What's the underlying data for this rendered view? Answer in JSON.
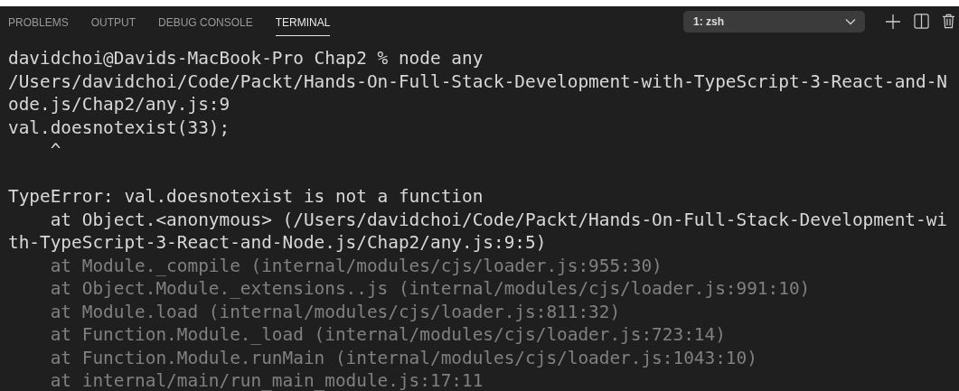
{
  "tabs": [
    {
      "label": "PROBLEMS",
      "selected": false
    },
    {
      "label": "OUTPUT",
      "selected": false
    },
    {
      "label": "DEBUG CONSOLE",
      "selected": false
    },
    {
      "label": "TERMINAL",
      "selected": true
    }
  ],
  "terminal_select": {
    "value": "1: zsh"
  },
  "terminal": {
    "blocks": [
      [
        {
          "kind": "normal",
          "text": "davidchoi@Davids-MacBook-Pro Chap2 % node any"
        },
        {
          "kind": "normal",
          "text": "/Users/davidchoi/Code/Packt/Hands-On-Full-Stack-Development-with-TypeScript-3-React-and-N"
        },
        {
          "kind": "normal",
          "text": "ode.js/Chap2/any.js:9"
        },
        {
          "kind": "normal",
          "text": "val.doesnotexist(33);"
        },
        {
          "kind": "normal",
          "text": "    ^"
        }
      ],
      [
        {
          "kind": "normal",
          "text": "TypeError: val.doesnotexist is not a function"
        },
        {
          "kind": "normal",
          "text": "    at Object.<anonymous> (/Users/davidchoi/Code/Packt/Hands-On-Full-Stack-Development-wi"
        },
        {
          "kind": "normal",
          "text": "th-TypeScript-3-React-and-Node.js/Chap2/any.js:9:5)"
        },
        {
          "kind": "dim",
          "text": "    at Module._compile (internal/modules/cjs/loader.js:955:30)"
        },
        {
          "kind": "dim",
          "text": "    at Object.Module._extensions..js (internal/modules/cjs/loader.js:991:10)"
        },
        {
          "kind": "dim",
          "text": "    at Module.load (internal/modules/cjs/loader.js:811:32)"
        },
        {
          "kind": "dim",
          "text": "    at Function.Module._load (internal/modules/cjs/loader.js:723:14)"
        },
        {
          "kind": "dim",
          "text": "    at Function.Module.runMain (internal/modules/cjs/loader.js:1043:10)"
        },
        {
          "kind": "dim",
          "text": "    at internal/main/run_main_module.js:17:11"
        }
      ]
    ]
  }
}
